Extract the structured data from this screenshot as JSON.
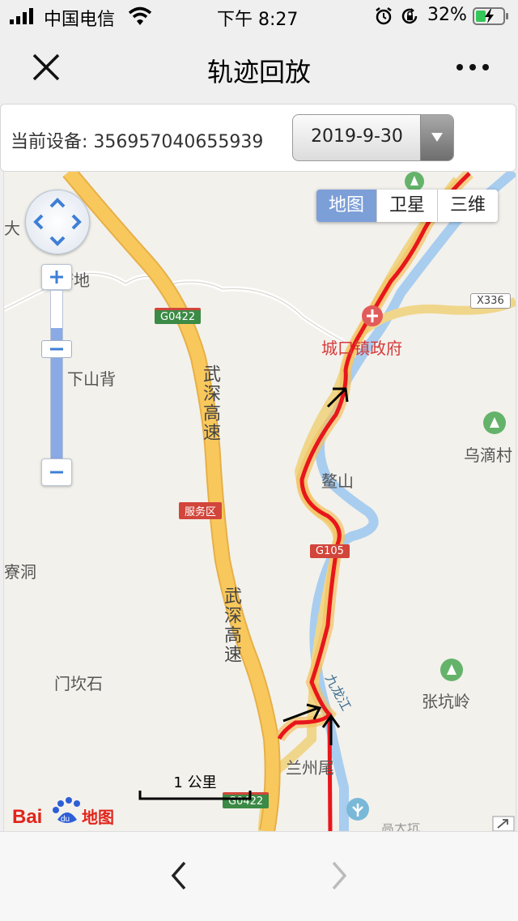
{
  "status_bar": {
    "carrier": "中国电信",
    "time": "下午 8:27",
    "battery": "32%"
  },
  "nav": {
    "title": "轨迹回放"
  },
  "device": {
    "label": "当前设备: 356957040655939",
    "date": "2019-9-30"
  },
  "map": {
    "type_buttons": [
      "地图",
      "卫星",
      "三维"
    ],
    "active_type": "地图",
    "labels": {
      "da": "大",
      "tandi": "塘地",
      "xiashanbei": "下山背",
      "chengkou": "城口镇政府",
      "wudi": "乌滴村",
      "aoshan": "鳌山",
      "dong": "寮洞",
      "menkanshi": "门坎石",
      "zhangkengling": "张坑岭",
      "lanzhou": "兰州尾",
      "highway_top": "武深高速",
      "highway_bottom": "武深高速",
      "river": "九龙江",
      "bottom_cut": "高大坑"
    },
    "shields": {
      "g0422_top": "G0422",
      "service_area": "服务区",
      "g105": "G105",
      "x336": "X336",
      "g0422_bottom": "G0422"
    },
    "scale": "1 公里",
    "logo_text": "Bai du 地图",
    "zoom_level_fraction": 0.78,
    "colors": {
      "track": "#e8161b",
      "highway": "#f7c95a",
      "water": "#a8cdef",
      "land": "#f3f1ec"
    }
  },
  "bottom": {
    "prev_icon": "chevron-left-icon",
    "next_icon": "chevron-right-icon"
  }
}
